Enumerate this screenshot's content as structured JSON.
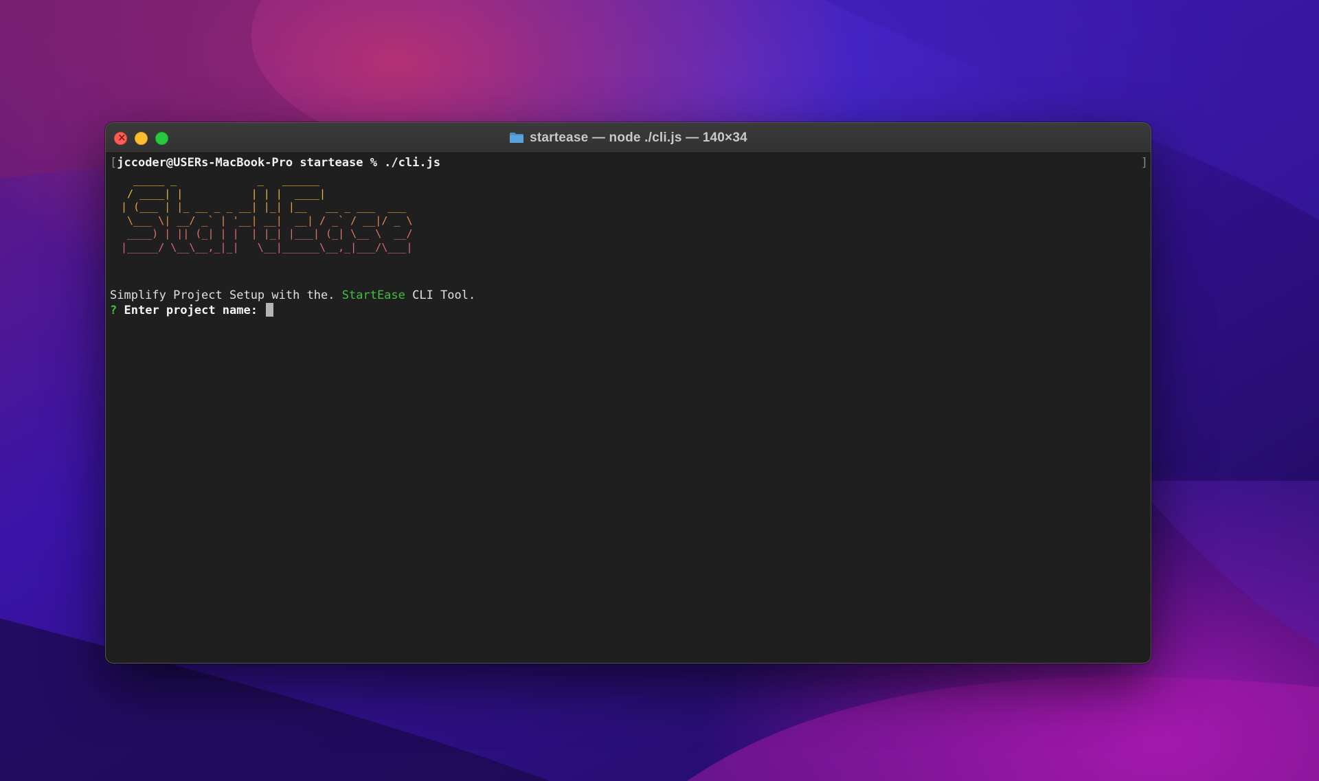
{
  "window": {
    "title": "startease — node ./cli.js — 140×34",
    "folder_icon": "folder-icon"
  },
  "terminal": {
    "prompt_line_bracket": "[",
    "prompt_line_command": "jccoder@USERs-MacBook-Pro startease % ./cli.js",
    "right_bracket": "]",
    "banner_lines": [
      "   _____ _             _   ______",
      "  / ____| |           | | |  ____|",
      " | (___ | |_ __ _ _ __| |_| |__   __ _ ___  ___",
      "  \\___ \\| __/ _` | '__| __|  __| / _` / __|/ _ \\",
      "  ____) | || (_| | |  | |_| |___| (_| \\__ \\  __/",
      " |_____/ \\__\\__,_|_|   \\__|______\\__,_|___/\\___|"
    ],
    "banner_colors": [
      "#f4c430",
      "#f2b73a",
      "#eea044",
      "#e88a52",
      "#e0736a",
      "#d96a7a"
    ],
    "tagline_prefix": "Simplify Project Setup with the. ",
    "tagline_highlight": "StartEase",
    "tagline_suffix": " CLI Tool.",
    "question_mark": "?",
    "question_label": "Enter project name:"
  },
  "colors": {
    "terminal_bg": "#1f1f1f",
    "accent_green": "#3fc13f"
  }
}
